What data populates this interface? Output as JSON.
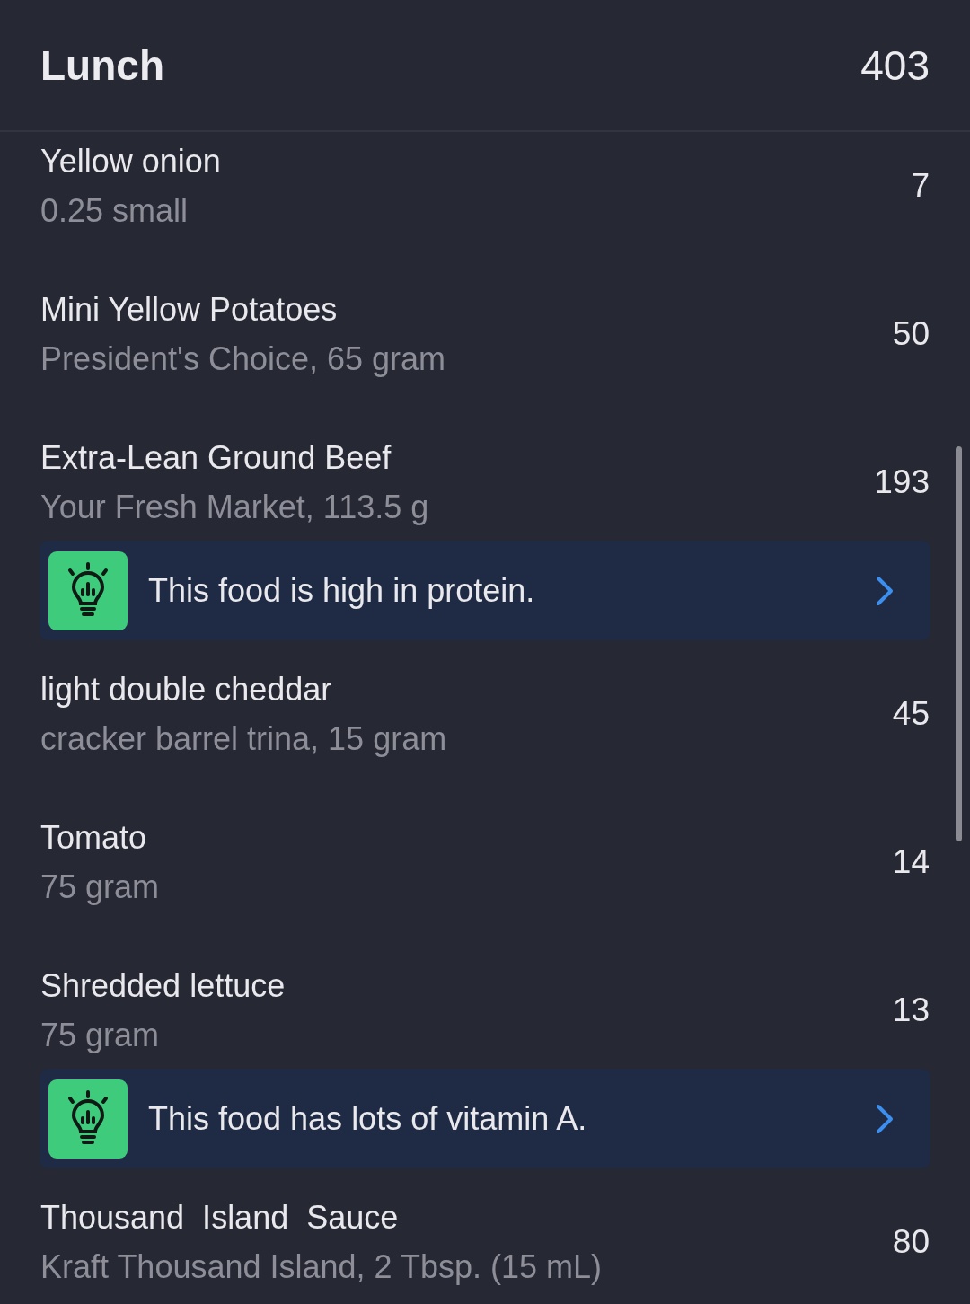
{
  "header": {
    "title": "Lunch",
    "calories": "403"
  },
  "foods": [
    {
      "name": "Yellow onion",
      "detail": "0.25 small",
      "calories": "7"
    },
    {
      "name": "Mini Yellow Potatoes",
      "detail": "President's Choice, 65 gram",
      "calories": "50"
    },
    {
      "name": "Extra-Lean Ground Beef",
      "detail": "Your Fresh Market, 113.5 g",
      "calories": "193",
      "insight": "This food is high in protein."
    },
    {
      "name": "light double cheddar",
      "detail": "cracker barrel trina, 15 gram",
      "calories": "45"
    },
    {
      "name": "Tomato",
      "detail": "75 gram",
      "calories": "14"
    },
    {
      "name": "Shredded lettuce",
      "detail": "75 gram",
      "calories": "13",
      "insight": "This food has lots of vitamin A."
    },
    {
      "name": "Thousand  Island  Sauce",
      "detail": "Kraft Thousand Island, 2 Tbsp. (15 mL)",
      "calories": "80"
    }
  ]
}
